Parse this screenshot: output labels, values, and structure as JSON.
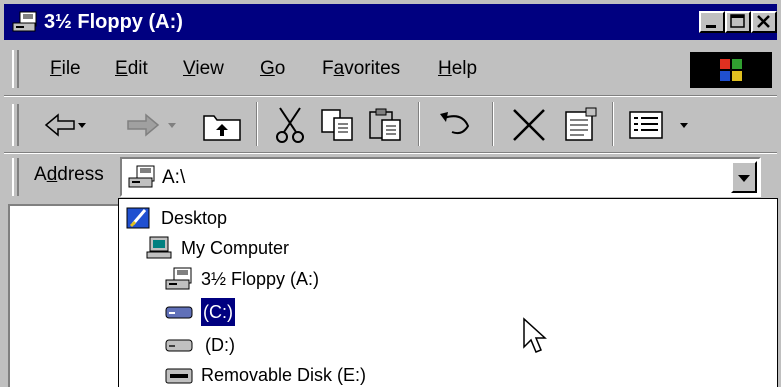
{
  "window": {
    "title": "3½ Floppy (A:)",
    "icon": "floppy-drive-icon"
  },
  "menu": {
    "items": [
      {
        "pre": "",
        "key": "F",
        "post": "ile"
      },
      {
        "pre": "",
        "key": "E",
        "post": "dit"
      },
      {
        "pre": "",
        "key": "V",
        "post": "iew"
      },
      {
        "pre": "",
        "key": "G",
        "post": "o"
      },
      {
        "pre": "F",
        "key": "a",
        "post": "vorites"
      },
      {
        "pre": "",
        "key": "H",
        "post": "elp"
      }
    ]
  },
  "toolbar": {
    "buttons": [
      "back-arrow-icon",
      "forward-arrow-icon",
      "up-folder-icon",
      "cut-icon",
      "copy-icon",
      "paste-icon",
      "undo-icon",
      "delete-icon",
      "properties-icon",
      "views-icon"
    ]
  },
  "address": {
    "label_pre": "A",
    "label_key": "d",
    "label_post": "dress",
    "value": "A:\\"
  },
  "dropdown": {
    "items": [
      {
        "label": "Desktop",
        "icon": "desktop-icon"
      },
      {
        "label": "My Computer",
        "icon": "my-computer-icon"
      },
      {
        "label": "3½ Floppy (A:)",
        "icon": "floppy-drive-icon"
      },
      {
        "label": "(C:)",
        "icon": "hard-drive-icon",
        "selected": true
      },
      {
        "label": "(D:)",
        "icon": "hard-drive-icon"
      },
      {
        "label": "Removable Disk (E:)",
        "icon": "removable-disk-icon"
      }
    ]
  }
}
